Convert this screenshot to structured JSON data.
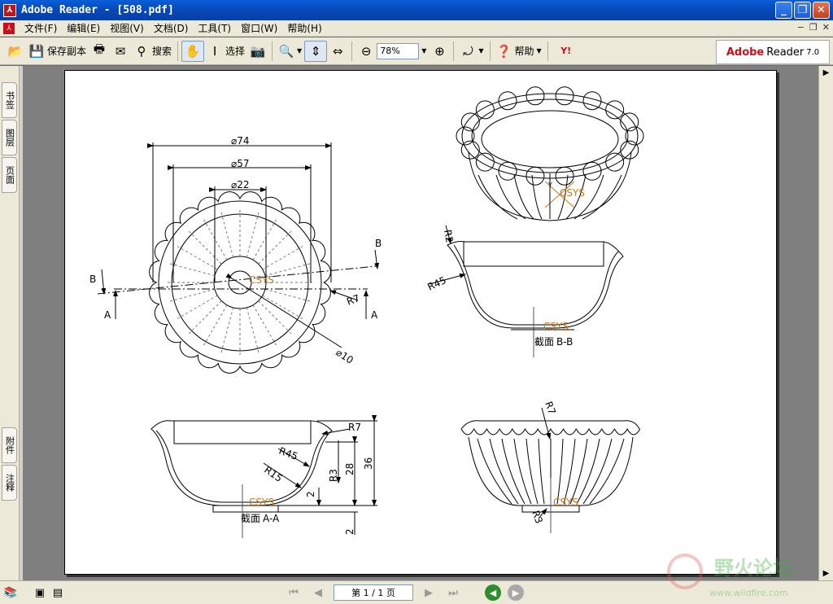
{
  "window": {
    "title": "Adobe Reader - [508.pdf]",
    "icon": "adobe-icon",
    "controls": [
      "_",
      "❐",
      "✕"
    ]
  },
  "menubar": {
    "items": [
      "文件(F)",
      "编辑(E)",
      "视图(V)",
      "文档(D)",
      "工具(T)",
      "窗口(W)",
      "帮助(H)"
    ],
    "mdi_controls": [
      "−",
      "❐",
      "✕"
    ]
  },
  "toolbar": {
    "save_copy": "保存副本",
    "search": "搜索",
    "select": "选择",
    "zoom": "78%",
    "help": "帮助",
    "brand_prefix": "Adobe",
    "brand_name": "Reader",
    "brand_version": "7.0"
  },
  "leftnav": {
    "tabs": [
      "书签",
      "图层",
      "页面",
      "附件",
      "注释"
    ]
  },
  "statusbar": {
    "page_display": "第 1 / 1 页"
  },
  "watermark": {
    "text": "野火论坛",
    "url": "www.wildfire.com"
  },
  "drawing": {
    "dim_phi74": "74",
    "dim_phi57": "57",
    "dim_phi22": "22",
    "dim_phi10": "10",
    "label_B": "B",
    "label_A": "A",
    "label_R7": "R7",
    "label_R2": "R2",
    "label_R45": "R45",
    "label_R15": "R15",
    "label_R3": "R3",
    "dim_28": "28",
    "dim_36": "36",
    "dim_2": "2",
    "csys": "CSYS",
    "axis_y": "Y",
    "axis_x": "X",
    "section_bb_prefix": "截面",
    "section_bb": "B-B",
    "section_aa_prefix": "截面",
    "section_aa": "A-A",
    "colors": {
      "line": "#000000",
      "csys": "#c8781e",
      "centerline": "#555555"
    }
  }
}
